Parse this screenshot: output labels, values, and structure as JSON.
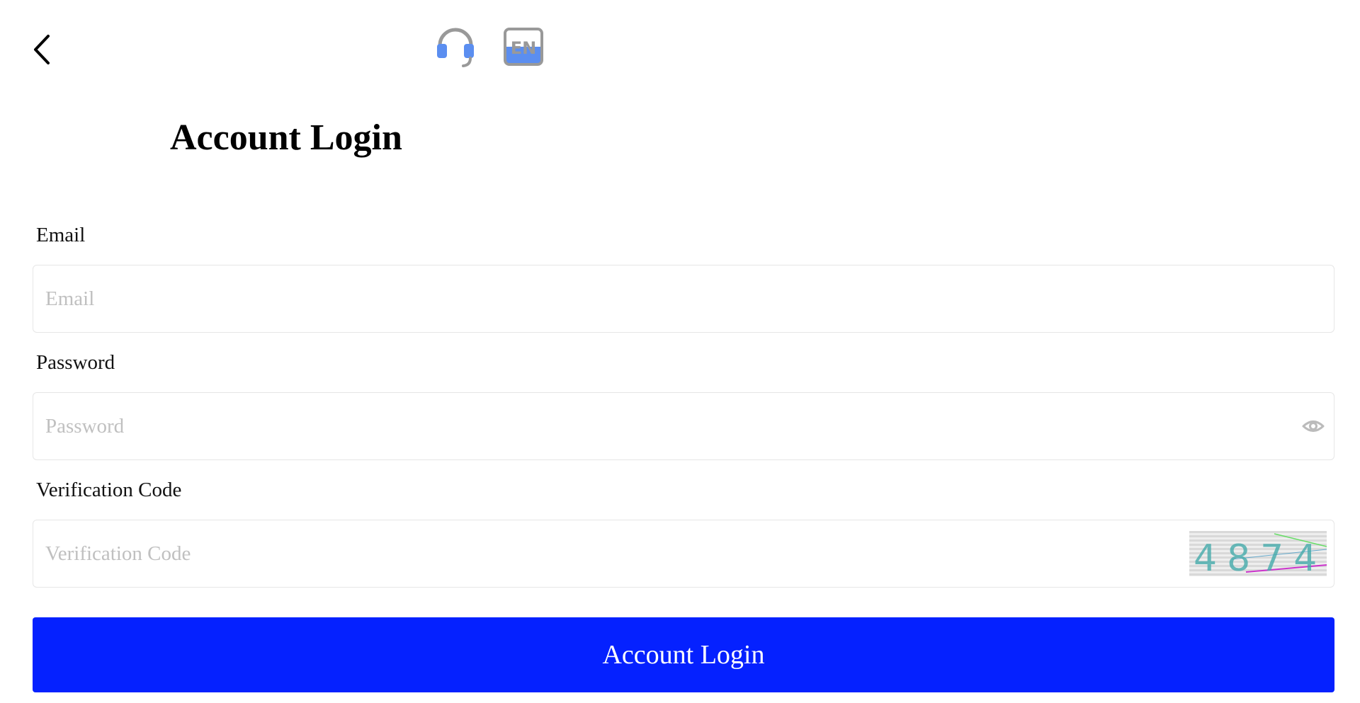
{
  "header": {
    "back_icon": "chevron-left-icon",
    "support_icon": "headset-icon",
    "language_label": "EN"
  },
  "title": "Account Login",
  "form": {
    "email": {
      "label": "Email",
      "placeholder": "Email",
      "value": ""
    },
    "password": {
      "label": "Password",
      "placeholder": "Password",
      "value": "",
      "toggle_icon": "eye-icon"
    },
    "verification": {
      "label": "Verification Code",
      "placeholder": "Verification Code",
      "value": "",
      "captcha_text": "4874"
    }
  },
  "submit_label": "Account Login",
  "colors": {
    "primary": "#0521ff",
    "icon_blue": "#5b8ef0",
    "icon_gray": "#999999",
    "placeholder": "#c0c0c0",
    "border": "#e6e6e6"
  }
}
